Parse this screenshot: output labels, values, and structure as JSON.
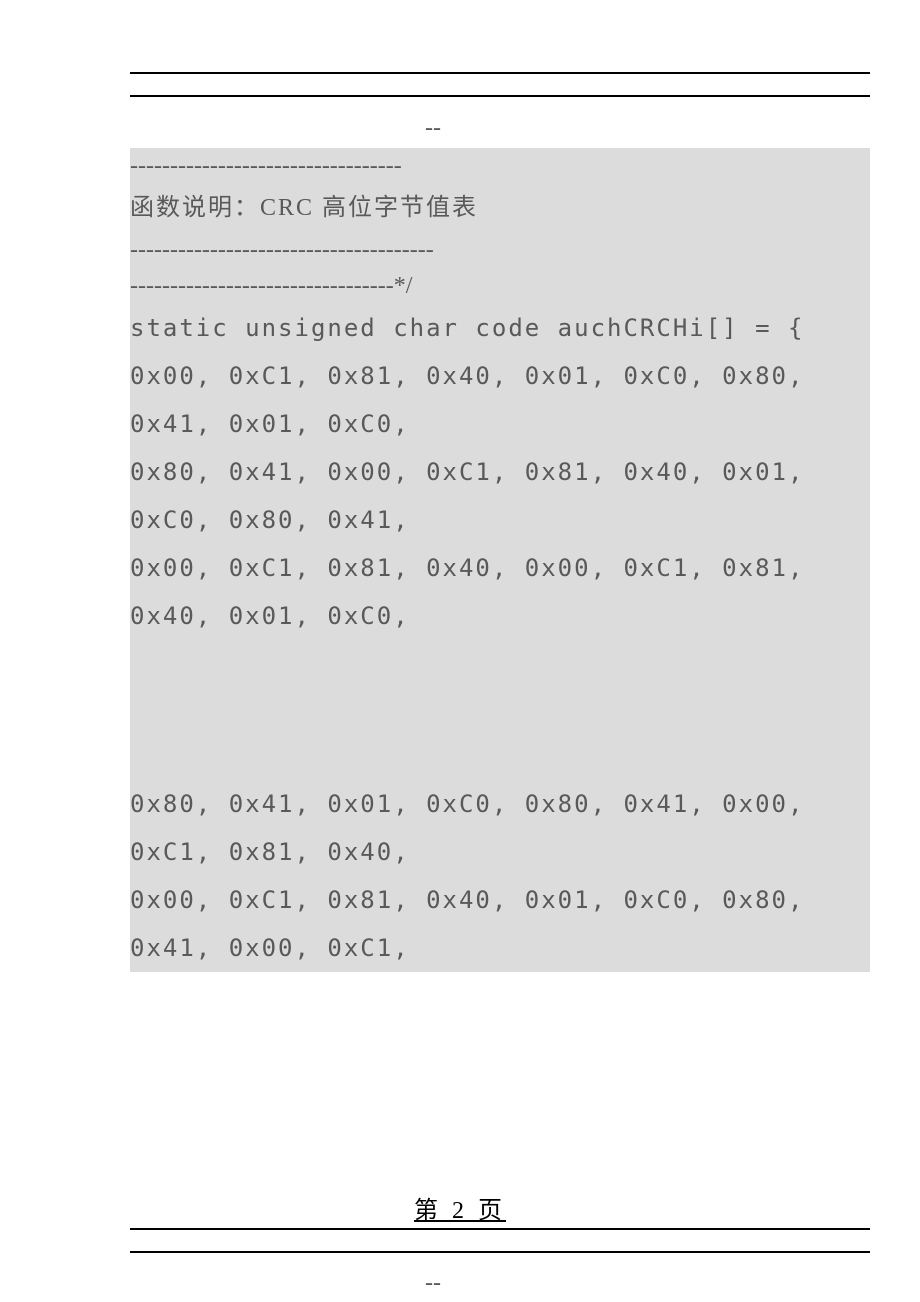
{
  "header": {
    "dash_marker": "--"
  },
  "code": {
    "dash1": "----------------------------------",
    "comment": "函数说明：CRC 高位字节值表",
    "dash2": "--------------------------------------",
    "dash3": "---------------------------------*/",
    "decl": "static unsigned char code auchCRCHi[] = {",
    "line1a": "0x00, 0xC1, 0x81, 0x40, 0x01, 0xC0, 0x80,",
    "line1b": "0x41, 0x01, 0xC0,",
    "line2a": "0x80, 0x41, 0x00, 0xC1, 0x81, 0x40, 0x01,",
    "line2b": "0xC0, 0x80, 0x41,",
    "line3a": "0x00, 0xC1, 0x81, 0x40, 0x00, 0xC1, 0x81,",
    "line3b": "0x40, 0x01, 0xC0,",
    "line4a": "0x80, 0x41, 0x01, 0xC0, 0x80, 0x41, 0x00,",
    "line4b": "0xC1, 0x81, 0x40,",
    "line5a": "0x00, 0xC1, 0x81, 0x40, 0x01, 0xC0, 0x80,",
    "line5b": "0x41, 0x00, 0xC1,"
  },
  "footer": {
    "page_label": "第 2 页",
    "dash_marker": "--"
  }
}
